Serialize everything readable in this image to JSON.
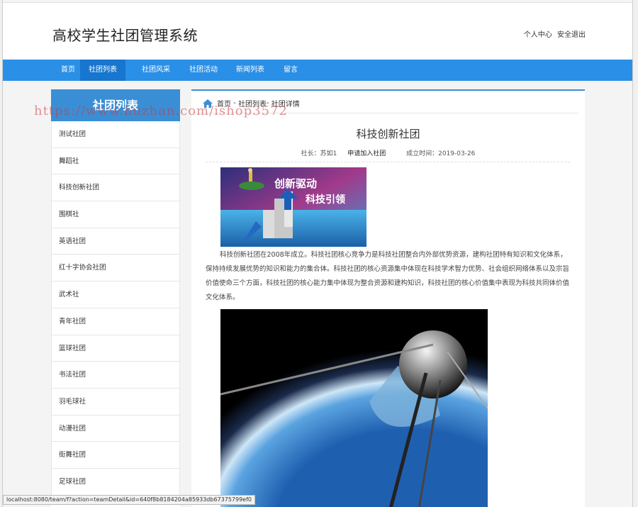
{
  "header": {
    "site_title": "高校学生社团管理系统",
    "user_center": "个人中心",
    "logout": "安全退出"
  },
  "nav": {
    "items": [
      {
        "label": "首页"
      },
      {
        "label": "社团列表"
      },
      {
        "label": "社团风采"
      },
      {
        "label": "社团活动"
      },
      {
        "label": "新闻列表"
      },
      {
        "label": "留言"
      }
    ],
    "active": "社团列表"
  },
  "sidebar": {
    "title": "社团列表",
    "items": [
      {
        "label": "测试社团"
      },
      {
        "label": "舞蹈社"
      },
      {
        "label": "科技创新社团"
      },
      {
        "label": "围棋社"
      },
      {
        "label": "英语社团"
      },
      {
        "label": "红十字协会社团"
      },
      {
        "label": "武术社"
      },
      {
        "label": "青年社团"
      },
      {
        "label": "篮球社团"
      },
      {
        "label": "书法社团"
      },
      {
        "label": "羽毛球社"
      },
      {
        "label": "动漫社团"
      },
      {
        "label": "街舞社团"
      },
      {
        "label": "足球社团"
      }
    ]
  },
  "breadcrumb": {
    "home": "首页",
    "sep1": " - ",
    "list": "社团列表",
    "sep2": "- ",
    "detail": "社团详情"
  },
  "club": {
    "title": "科技创新社团",
    "president_label": "社长：",
    "president": "苏如1",
    "join_label": "申请加入社团",
    "founded_label": "成立时间：",
    "founded": "2019-03-26",
    "banner_text_1": "创新驱动",
    "banner_text_2": "科技引领",
    "description": "科技创新社团在2008年成立。科技社团核心竞争力是科技社团整合内外部优势资源，建构社团特有知识和文化体系，保持持续发展优势的知识和能力的集合体。科技社团的核心资源集中体现在科技学术智力优势、社会组织网络体系以及宗旨价值使命三个方面，科技社团的核心能力集中体现为整合资源和建构知识，科技社团的核心价值集中表现为科技共同体价值文化体系。"
  },
  "watermark": "https://www.huzhan.com/ishop3572",
  "statusbar": "localhost:8080/team/f?action=teamDetail&id=640f8b8184204a85933db67375799ef0",
  "colors": {
    "nav_bg": "#2a8fe6",
    "nav_active": "#1776cf",
    "sidebar_head": "#3a8ed6"
  }
}
